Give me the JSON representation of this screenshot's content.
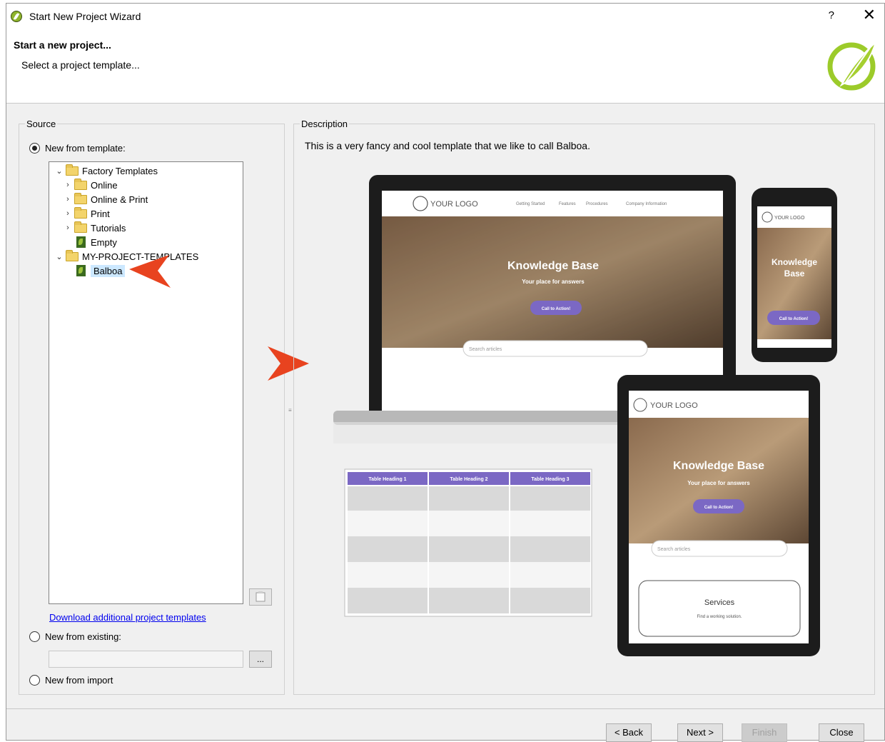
{
  "window": {
    "title": "Start New Project Wizard",
    "help_label": "?",
    "close_label": "✕"
  },
  "header": {
    "title": "Start a new project...",
    "subtitle": "Select a project template..."
  },
  "source": {
    "label": "Source",
    "new_from_template": "New from template:",
    "tree": {
      "factory": "Factory Templates",
      "online": "Online",
      "online_print": "Online & Print",
      "print": "Print",
      "tutorials": "Tutorials",
      "empty": "Empty",
      "my_templates": "MY-PROJECT-TEMPLATES",
      "balboa": "Balboa"
    },
    "download_link": "Download additional project templates",
    "new_from_existing": "New from existing:",
    "browse_label": "...",
    "new_from_import": "New from import"
  },
  "description": {
    "label": "Description",
    "text": "This is a very fancy and cool template that we like to call Balboa."
  },
  "preview": {
    "logo": "YOUR LOGO",
    "nav": [
      "Getting Started",
      "Features",
      "Procedures",
      "Company Information"
    ],
    "kb_title": "Knowledge Base",
    "kb_sub": "Your place for answers",
    "cta": "Call to Action!",
    "search": "Search articles",
    "services": "Services",
    "services_sub": "Find a working solution.",
    "table_headings": [
      "Table Heading 1",
      "Table Heading 2",
      "Table Heading 3"
    ]
  },
  "buttons": {
    "back": "< Back",
    "next": "Next >",
    "finish": "Finish",
    "close": "Close"
  },
  "colors": {
    "accent_purple": "#7b68c4",
    "arrow_red": "#e8431f",
    "brand_green": "#8fc31f"
  }
}
